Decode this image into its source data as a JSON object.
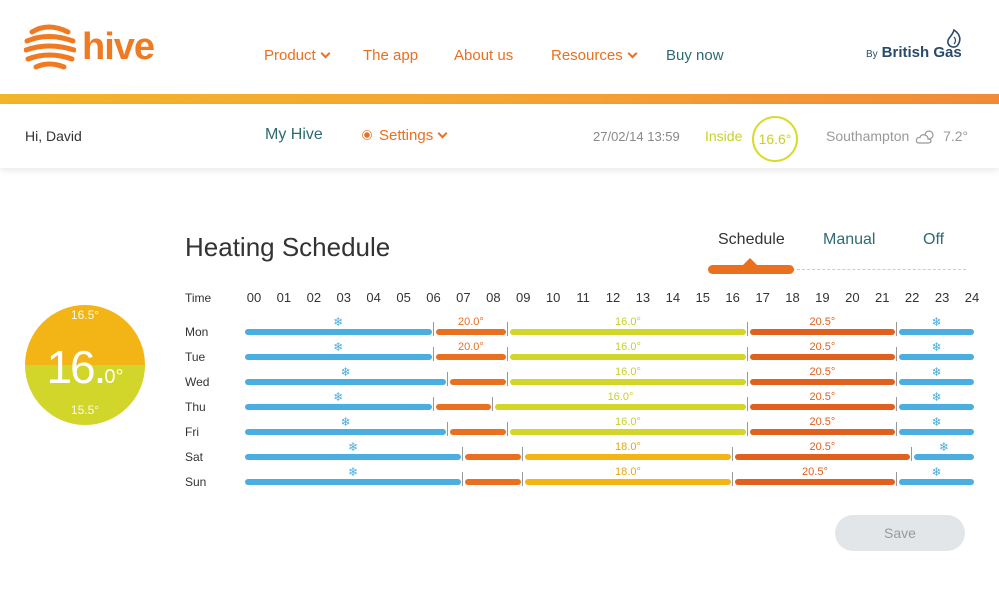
{
  "brand": {
    "name": "hive",
    "partner_by": "By",
    "partner_name": "British Gas"
  },
  "nav": {
    "product": "Product",
    "app": "The app",
    "about": "About us",
    "resources": "Resources",
    "buy": "Buy now"
  },
  "subheader": {
    "greeting": "Hi, David",
    "my_hive": "My Hive",
    "settings": "Settings",
    "datetime": "27/02/14 13:59",
    "inside_label": "Inside",
    "inside_temp": "16.6°",
    "location": "Southampton",
    "weather_icon": "cloud-sun-icon",
    "outside_temp": "7.2°"
  },
  "thermostat": {
    "upper": "16.5°",
    "current_whole": "16.",
    "current_decimal": "0°",
    "lower": "15.5°"
  },
  "schedule": {
    "title": "Heating Schedule",
    "modes": [
      "Schedule",
      "Manual",
      "Off"
    ],
    "active_mode": "Schedule",
    "time_label": "Time",
    "hours": [
      "00",
      "01",
      "02",
      "03",
      "04",
      "05",
      "06",
      "07",
      "08",
      "09",
      "10",
      "11",
      "12",
      "13",
      "14",
      "15",
      "16",
      "17",
      "18",
      "19",
      "20",
      "21",
      "22",
      "23",
      "24"
    ],
    "days": [
      {
        "day": "Mon",
        "segments": [
          {
            "start": 0,
            "end": 6,
            "type": "frost",
            "label": ""
          },
          {
            "start": 6,
            "end": 8.5,
            "type": "warm",
            "label": "20.0°"
          },
          {
            "start": 8.5,
            "end": 16.5,
            "type": "mild",
            "label": "16.0°"
          },
          {
            "start": 16.5,
            "end": 21.5,
            "type": "hot",
            "label": "20.5°"
          },
          {
            "start": 21.5,
            "end": 24,
            "type": "frost",
            "label": ""
          }
        ]
      },
      {
        "day": "Tue",
        "segments": [
          {
            "start": 0,
            "end": 6,
            "type": "frost",
            "label": ""
          },
          {
            "start": 6,
            "end": 8.5,
            "type": "warm",
            "label": "20.0°"
          },
          {
            "start": 8.5,
            "end": 16.5,
            "type": "mild",
            "label": "16.0°"
          },
          {
            "start": 16.5,
            "end": 21.5,
            "type": "hot",
            "label": "20.5°"
          },
          {
            "start": 21.5,
            "end": 24,
            "type": "frost",
            "label": ""
          }
        ]
      },
      {
        "day": "Wed",
        "segments": [
          {
            "start": 0,
            "end": 6.5,
            "type": "frost",
            "label": ""
          },
          {
            "start": 6.5,
            "end": 8.5,
            "type": "warm",
            "label": ""
          },
          {
            "start": 8.5,
            "end": 16.5,
            "type": "mild",
            "label": "16.0°"
          },
          {
            "start": 16.5,
            "end": 21.5,
            "type": "hot",
            "label": "20.5°"
          },
          {
            "start": 21.5,
            "end": 24,
            "type": "frost",
            "label": ""
          }
        ]
      },
      {
        "day": "Thu",
        "segments": [
          {
            "start": 0,
            "end": 6,
            "type": "frost",
            "label": ""
          },
          {
            "start": 6,
            "end": 8,
            "type": "warm",
            "label": ""
          },
          {
            "start": 8,
            "end": 16.5,
            "type": "mild",
            "label": "16.0°"
          },
          {
            "start": 16.5,
            "end": 21.5,
            "type": "hot",
            "label": "20.5°"
          },
          {
            "start": 21.5,
            "end": 24,
            "type": "frost",
            "label": ""
          }
        ]
      },
      {
        "day": "Fri",
        "segments": [
          {
            "start": 0,
            "end": 6.5,
            "type": "frost",
            "label": ""
          },
          {
            "start": 6.5,
            "end": 8.5,
            "type": "warm",
            "label": ""
          },
          {
            "start": 8.5,
            "end": 16.5,
            "type": "mild",
            "label": "16.0°"
          },
          {
            "start": 16.5,
            "end": 21.5,
            "type": "hot",
            "label": "20.5°"
          },
          {
            "start": 21.5,
            "end": 24,
            "type": "frost",
            "label": ""
          }
        ]
      },
      {
        "day": "Sat",
        "segments": [
          {
            "start": 0,
            "end": 7,
            "type": "frost",
            "label": ""
          },
          {
            "start": 7,
            "end": 9,
            "type": "warm",
            "label": ""
          },
          {
            "start": 9,
            "end": 16,
            "type": "gold",
            "label": "18.0°"
          },
          {
            "start": 16,
            "end": 22,
            "type": "hot",
            "label": "20.5°"
          },
          {
            "start": 22,
            "end": 24,
            "type": "frost",
            "label": ""
          }
        ]
      },
      {
        "day": "Sun",
        "segments": [
          {
            "start": 0,
            "end": 7,
            "type": "frost",
            "label": ""
          },
          {
            "start": 7,
            "end": 9,
            "type": "warm",
            "label": ""
          },
          {
            "start": 9,
            "end": 16,
            "type": "gold",
            "label": "18.0°"
          },
          {
            "start": 16,
            "end": 21.5,
            "type": "hot",
            "label": "20.5°"
          },
          {
            "start": 21.5,
            "end": 24,
            "type": "frost",
            "label": ""
          }
        ]
      }
    ],
    "frost_icon": "snowflake-icon"
  },
  "actions": {
    "save": "Save"
  },
  "colors": {
    "brand_orange": "#f07a22",
    "teal": "#2d6b72",
    "frost": "#4aaee0",
    "mild": "#d2d52a",
    "hot": "#e0601e",
    "gold": "#f3b516"
  }
}
